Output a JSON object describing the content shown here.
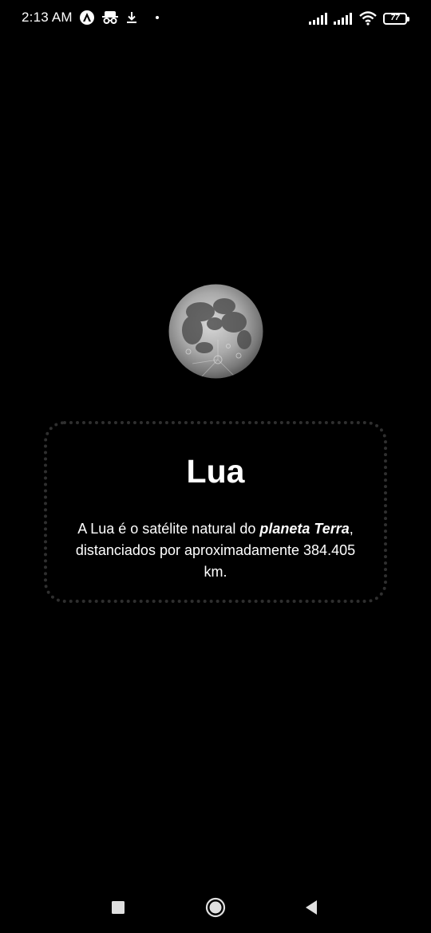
{
  "status_bar": {
    "time": "2:13 AM",
    "battery_level": "77",
    "icons": [
      "assistant-icon",
      "incognito-icon",
      "download-icon",
      "dot-icon",
      "signal-icon",
      "signal-icon-2",
      "wifi-icon",
      "battery-icon"
    ]
  },
  "moon": {
    "icon": "moon-image"
  },
  "card": {
    "title": "Lua",
    "desc_part1": "A Lua é o satélite natural do ",
    "desc_bold": "planeta Terra",
    "desc_part2": ", distanciados por aproximadamente 384.405 km."
  },
  "nav": {
    "icons": [
      "recent-apps-icon",
      "home-icon",
      "back-icon"
    ]
  },
  "colors": {
    "background": "#000000",
    "text": "#ffffff",
    "card_border": "#2f2f2f"
  }
}
